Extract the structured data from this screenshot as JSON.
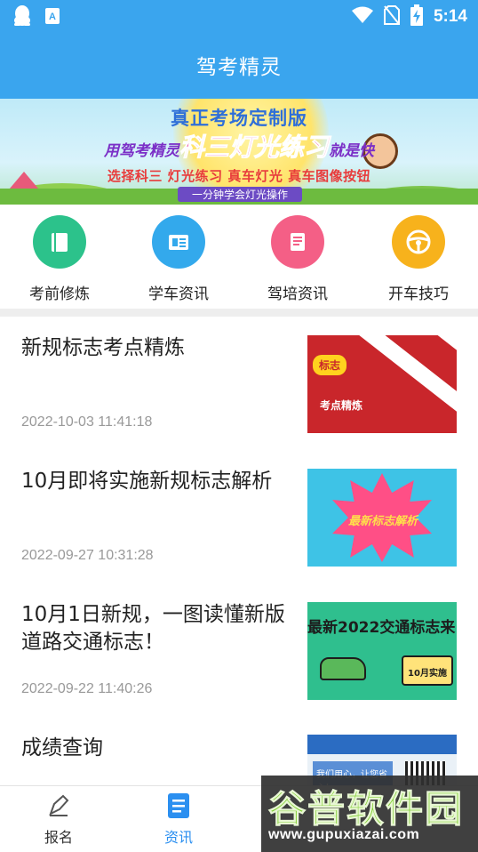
{
  "status_bar": {
    "time": "5:14",
    "left_icons": [
      "qq-penguin-icon",
      "keyboard-a-icon"
    ],
    "right_icons": [
      "wifi-icon",
      "no-sim-icon",
      "battery-charging-icon"
    ]
  },
  "app_bar": {
    "title": "驾考精灵"
  },
  "banner": {
    "line1": "真正考场定制版",
    "line2_prefix": "用驾考精灵",
    "line2_highlight": "科三灯光练习",
    "line2_suffix": "就是快",
    "line3": "选择科三 灯光练习 真车灯光 真车图像按钮",
    "line4": "一分钟学会灯光操作"
  },
  "quick_menu": [
    {
      "label": "考前修炼",
      "icon": "book-icon",
      "color": "#2cc28b"
    },
    {
      "label": "学车资讯",
      "icon": "newspaper-icon",
      "color": "#33a9ec"
    },
    {
      "label": "驾培资讯",
      "icon": "document-icon",
      "color": "#f45f86"
    },
    {
      "label": "开车技巧",
      "icon": "steering-wheel-icon",
      "color": "#f7b21c"
    }
  ],
  "news": [
    {
      "title": "新规标志考点精炼",
      "date": "2022-10-03 11:41:18",
      "thumb": {
        "tag": "标志",
        "text": "考点精炼"
      }
    },
    {
      "title": "10月即将实施新规标志解析",
      "date": "2022-09-27 10:31:28",
      "thumb": {
        "text": "最新标志解析"
      }
    },
    {
      "title": "10月1日新规，一图读懂新版道路交通标志！",
      "date": "2022-09-22 11:40:26",
      "thumb": {
        "text": "最新2022交通标志来",
        "badge": "10月实施"
      }
    },
    {
      "title": "成绩查询",
      "date": "",
      "thumb": {
        "text": "我们用心，让您省心！"
      }
    }
  ],
  "tab_bar": [
    {
      "label": "报名",
      "icon": "pen-icon",
      "active": false
    },
    {
      "label": "资讯",
      "icon": "news-document-icon",
      "active": true
    }
  ],
  "watermark": {
    "text": "谷普软件园",
    "url": "www.gupuxiazai.com"
  },
  "colors": {
    "primary": "#3aa5ee",
    "tab_active": "#2b8ff0",
    "date_gray": "#999999"
  }
}
